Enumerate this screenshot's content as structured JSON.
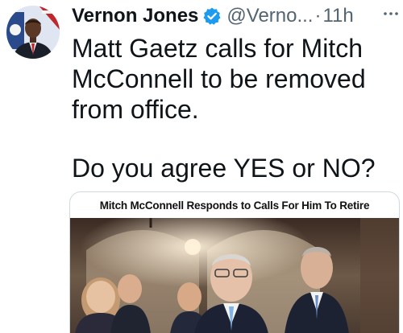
{
  "tweet": {
    "author": {
      "display_name": "Vernon Jones",
      "handle": "@Verno...",
      "separator": "·",
      "time": "11h",
      "verified": true,
      "avatar_icon": "profile-photo"
    },
    "text_lines": [
      "Matt Gaetz calls for Mitch",
      "McConnell to be removed",
      "from office."
    ],
    "question": "Do you agree YES or NO?",
    "media": {
      "headline": "Mitch McConnell Responds to Calls For Him To Retire"
    },
    "icons": {
      "verified": "verified-badge-icon",
      "more": "more-options-icon"
    },
    "colors": {
      "verified_blue": "#1d9bf0",
      "secondary_text": "#536471",
      "primary_text": "#0f1419"
    }
  }
}
